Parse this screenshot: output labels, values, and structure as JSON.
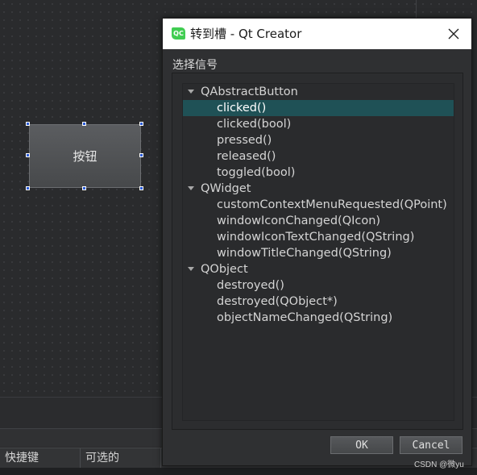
{
  "dialog": {
    "title": "转到槽 - Qt Creator",
    "logo_text": "QC",
    "section_label": "选择信号",
    "ok_label": "OK",
    "cancel_label": "Cancel"
  },
  "signal_tree": [
    {
      "label": "QAbstractButton",
      "kind": "group"
    },
    {
      "label": "clicked()",
      "kind": "item",
      "selected": true
    },
    {
      "label": "clicked(bool)",
      "kind": "item"
    },
    {
      "label": "pressed()",
      "kind": "item"
    },
    {
      "label": "released()",
      "kind": "item"
    },
    {
      "label": "toggled(bool)",
      "kind": "item"
    },
    {
      "label": "QWidget",
      "kind": "group"
    },
    {
      "label": "customContextMenuRequested(QPoint)",
      "kind": "item"
    },
    {
      "label": "windowIconChanged(QIcon)",
      "kind": "item"
    },
    {
      "label": "windowIconTextChanged(QString)",
      "kind": "item"
    },
    {
      "label": "windowTitleChanged(QString)",
      "kind": "item"
    },
    {
      "label": "QObject",
      "kind": "group"
    },
    {
      "label": "destroyed()",
      "kind": "item"
    },
    {
      "label": "destroyed(QObject*)",
      "kind": "item"
    },
    {
      "label": "objectNameChanged(QString)",
      "kind": "item"
    }
  ],
  "designer": {
    "button_label": "按钮"
  },
  "table_header": {
    "shortcut": "快捷键",
    "checkable": "可选的"
  },
  "watermark": "CSDN @微yu",
  "icons": {
    "close": "close-icon",
    "expand": "chevron-down-icon",
    "logo": "qt-creator-logo-icon"
  },
  "colors": {
    "selection": "#1f5156",
    "logo_green": "#41cd52",
    "handle_blue": "#2a5bd7"
  }
}
